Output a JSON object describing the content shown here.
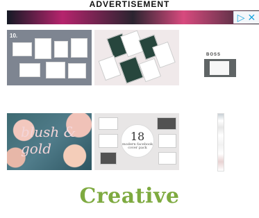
{
  "ad": {
    "label": "ADVERTISEMENT",
    "choices": "▷ ✕"
  },
  "tiles": {
    "t1": {
      "text": "10."
    },
    "t3": {
      "text": "BOSS"
    },
    "t4": {
      "text": "blush & gold"
    },
    "t5": {
      "number": "18",
      "caption": "modern facebook cover pack"
    }
  },
  "footer": {
    "logo_text": "Creative"
  }
}
